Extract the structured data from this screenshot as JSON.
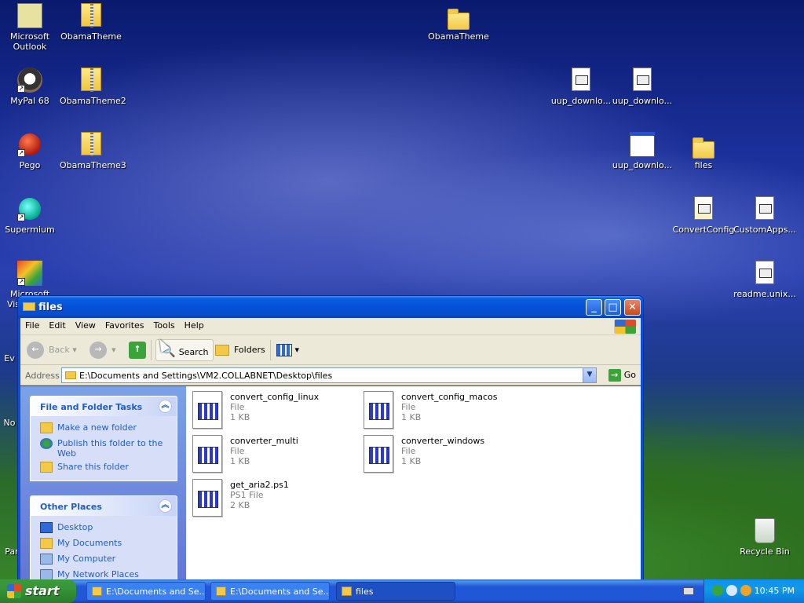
{
  "desktop": {
    "icons": [
      {
        "label": "Microsoft Outlook",
        "icon": "outlook-icon"
      },
      {
        "label": "ObamaTheme",
        "icon": "zip-folder-icon"
      },
      {
        "label": "ObamaTheme",
        "icon": "folder-icon"
      },
      {
        "label": "MyPal 68",
        "icon": "mypal-icon"
      },
      {
        "label": "ObamaTheme2",
        "icon": "zip-folder-icon"
      },
      {
        "label": "uup_downlo...",
        "icon": "cmd-script-icon"
      },
      {
        "label": "uup_downlo...",
        "icon": "cmd-script-icon"
      },
      {
        "label": "Pego",
        "icon": "pego-icon"
      },
      {
        "label": "ObamaTheme3",
        "icon": "zip-folder-icon"
      },
      {
        "label": "uup_downlo...",
        "icon": "gear-window-icon"
      },
      {
        "label": "files",
        "icon": "folder-icon"
      },
      {
        "label": "Supermium",
        "icon": "supermium-icon"
      },
      {
        "label": "ConvertConfig",
        "icon": "notepad-icon"
      },
      {
        "label": "CustomApps...",
        "icon": "text-file-icon"
      },
      {
        "label": "Microsoft Visual St...",
        "icon": "visual-studio-icon"
      },
      {
        "label": "readme.unix...",
        "icon": "cmd-script-icon"
      },
      {
        "label": "Recycle Bin",
        "icon": "recycle-bin-icon"
      }
    ],
    "partial_labels": [
      "Ev",
      "No",
      "Par"
    ]
  },
  "window": {
    "title": "files",
    "menu": [
      "File",
      "Edit",
      "View",
      "Favorites",
      "Tools",
      "Help"
    ],
    "toolbar": {
      "back": "Back",
      "search": "Search",
      "folders": "Folders"
    },
    "address": {
      "label": "Address",
      "value": "E:\\Documents and Settings\\VM2.COLLABNET\\Desktop\\files",
      "go": "Go"
    },
    "tasks_panel": {
      "title": "File and Folder Tasks",
      "items": [
        "Make a new folder",
        "Publish this folder to the Web",
        "Share this folder"
      ]
    },
    "places_panel": {
      "title": "Other Places",
      "items": [
        "Desktop",
        "My Documents",
        "My Computer",
        "My Network Places"
      ]
    },
    "files": [
      {
        "name": "convert_config_linux",
        "type": "File",
        "size": "1 KB"
      },
      {
        "name": "convert_config_macos",
        "type": "File",
        "size": "1 KB"
      },
      {
        "name": "converter_multi",
        "type": "File",
        "size": "1 KB"
      },
      {
        "name": "converter_windows",
        "type": "File",
        "size": "1 KB"
      },
      {
        "name": "get_aria2.ps1",
        "type": "PS1 File",
        "size": "2 KB"
      }
    ]
  },
  "taskbar": {
    "start": "start",
    "buttons": [
      {
        "label": "E:\\Documents and Se...",
        "active": false
      },
      {
        "label": "E:\\Documents and Se...",
        "active": false
      },
      {
        "label": "files",
        "active": true
      }
    ],
    "clock": "10:45 PM"
  }
}
